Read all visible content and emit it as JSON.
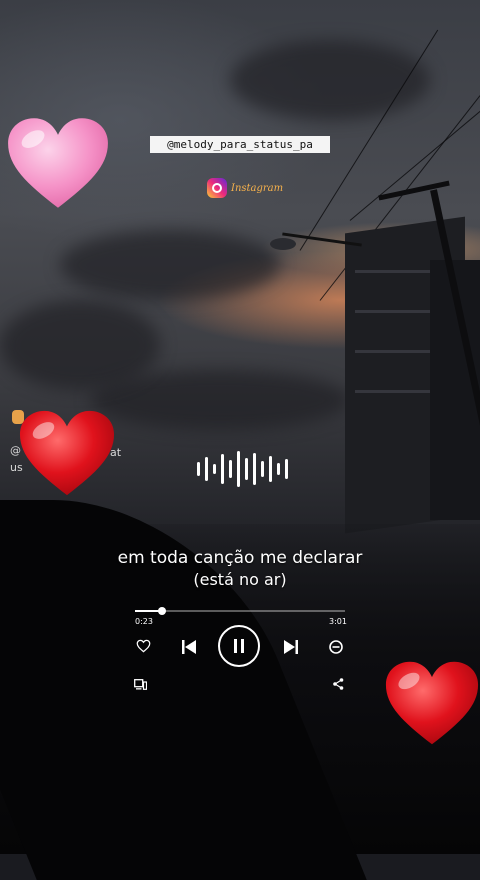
{
  "overlay": {
    "handle": "@melody_para_status_pa",
    "instagram_label": "Instagram",
    "side_fragment_top": "@",
    "side_fragment_top_right": "at",
    "side_fragment_bottom": "us"
  },
  "player": {
    "lyric_line_1": "em toda canção me declarar",
    "lyric_line_2": "(está no ar)",
    "elapsed": "0:23",
    "duration": "3:01",
    "progress_fraction": 0.127
  },
  "icons": {
    "like": "heart-outline-icon",
    "previous": "skip-previous-icon",
    "pause": "pause-icon",
    "next": "skip-next-icon",
    "remove": "minus-circle-icon",
    "devices": "devices-icon",
    "share": "share-icon"
  },
  "colors": {
    "heart_red": "#e0121c",
    "heart_pink": "#f58fc4",
    "instagram_gold": "#f6b14c"
  }
}
